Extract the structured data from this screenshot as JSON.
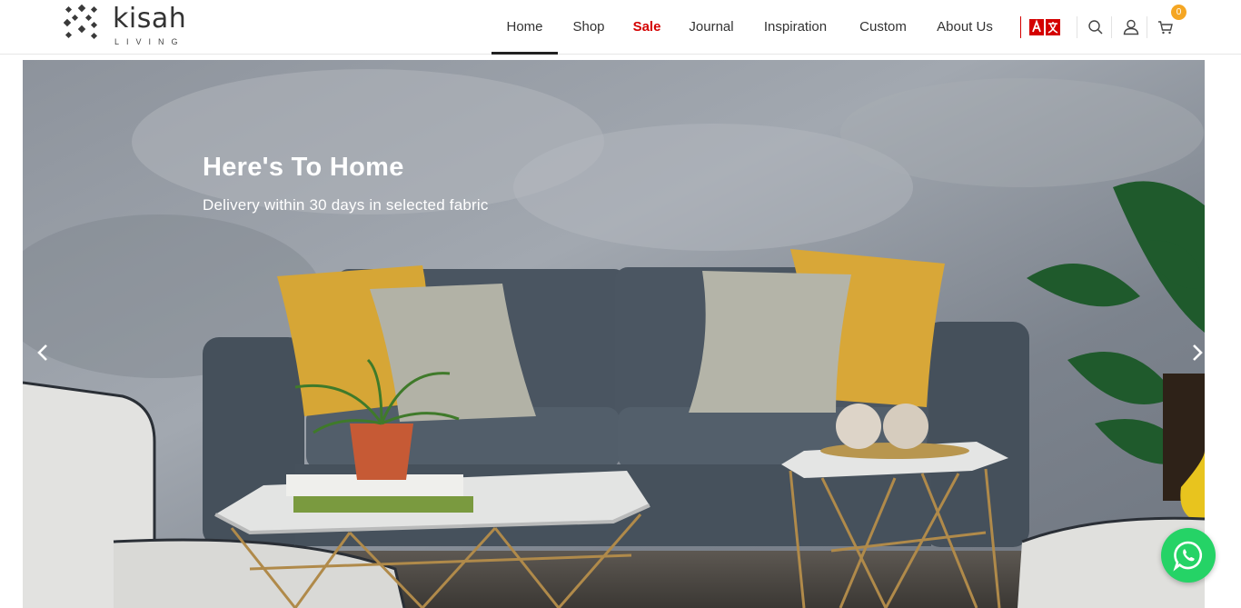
{
  "brand": {
    "name": "kisah",
    "sub": "LIVING"
  },
  "nav": {
    "items": [
      {
        "label": "Home",
        "active": true
      },
      {
        "label": "Shop"
      },
      {
        "label": "Sale",
        "highlight": true
      },
      {
        "label": "Journal"
      },
      {
        "label": "Inspiration"
      },
      {
        "label": "Custom"
      },
      {
        "label": "About Us"
      }
    ]
  },
  "toolbar": {
    "language_icon": "translate-icon",
    "search_icon": "search-icon",
    "account_icon": "user-icon",
    "cart_icon": "cart-icon",
    "cart_count": "0"
  },
  "hero": {
    "title": "Here's To Home",
    "subtitle": "Delivery within 30 days in selected fabric",
    "prev_icon": "chevron-left-icon",
    "next_icon": "chevron-right-icon"
  },
  "chat": {
    "icon": "whatsapp-icon"
  },
  "colors": {
    "sale": "#d40000",
    "badge": "#f5a623",
    "whatsapp": "#25d366"
  }
}
